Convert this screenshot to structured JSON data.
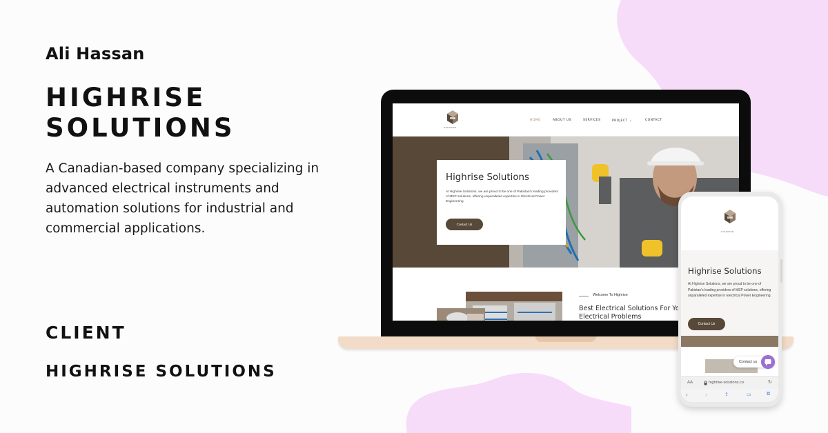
{
  "author": "Ali Hassan",
  "project": {
    "title": "HIGHRISE SOLUTIONS",
    "description": "A Canadian-based company specializing in advanced electrical instruments and automation solutions for industrial and commercial applications."
  },
  "client": {
    "label": "CLIENT",
    "name": "HIGHRISE SOLUTIONS"
  },
  "colors": {
    "accent_brown": "#574838",
    "blob_pink": "#f6dcf8",
    "laptop_base": "#f3dcc7"
  },
  "laptop_site": {
    "logo_text": "HIGHRISE",
    "nav": [
      "HOME",
      "ABOUT US",
      "SERVICES",
      "PROJECT",
      "CONTACT"
    ],
    "hero_title": "Highrise Solutions",
    "hero_text": "At Highrise Solutions, we are proud to be one of Pakistan's leading providers of MEP solutions, offering unparalleled expertise in Electrical Power Engineering.",
    "hero_button": "Contact Us",
    "welcome": "Welcome To Highrise",
    "best_title": "Best Electrical Solutions For Your Electrical Problems"
  },
  "phone_site": {
    "logo_text": "HIGHRISE",
    "hero_title": "Highrise Solutions",
    "hero_text": "At Highrise Solutions, we are proud to be one of Pakistan's leading providers of MEP solutions, offering unparalleled expertise in Electrical Power Engineering.",
    "hero_button": "Contact Us",
    "contact_pill": "Contact us",
    "address_aa": "AA",
    "url": "highrise-solutions.co"
  },
  "icons": {
    "lock": "lock-icon",
    "reload": "reload-icon",
    "back": "back-arrow-icon",
    "forward": "forward-arrow-icon",
    "share": "share-icon",
    "bookmarks": "bookmarks-icon",
    "tabs": "tabs-icon",
    "chat": "chat-icon",
    "chevron": "chevron-down-icon"
  }
}
